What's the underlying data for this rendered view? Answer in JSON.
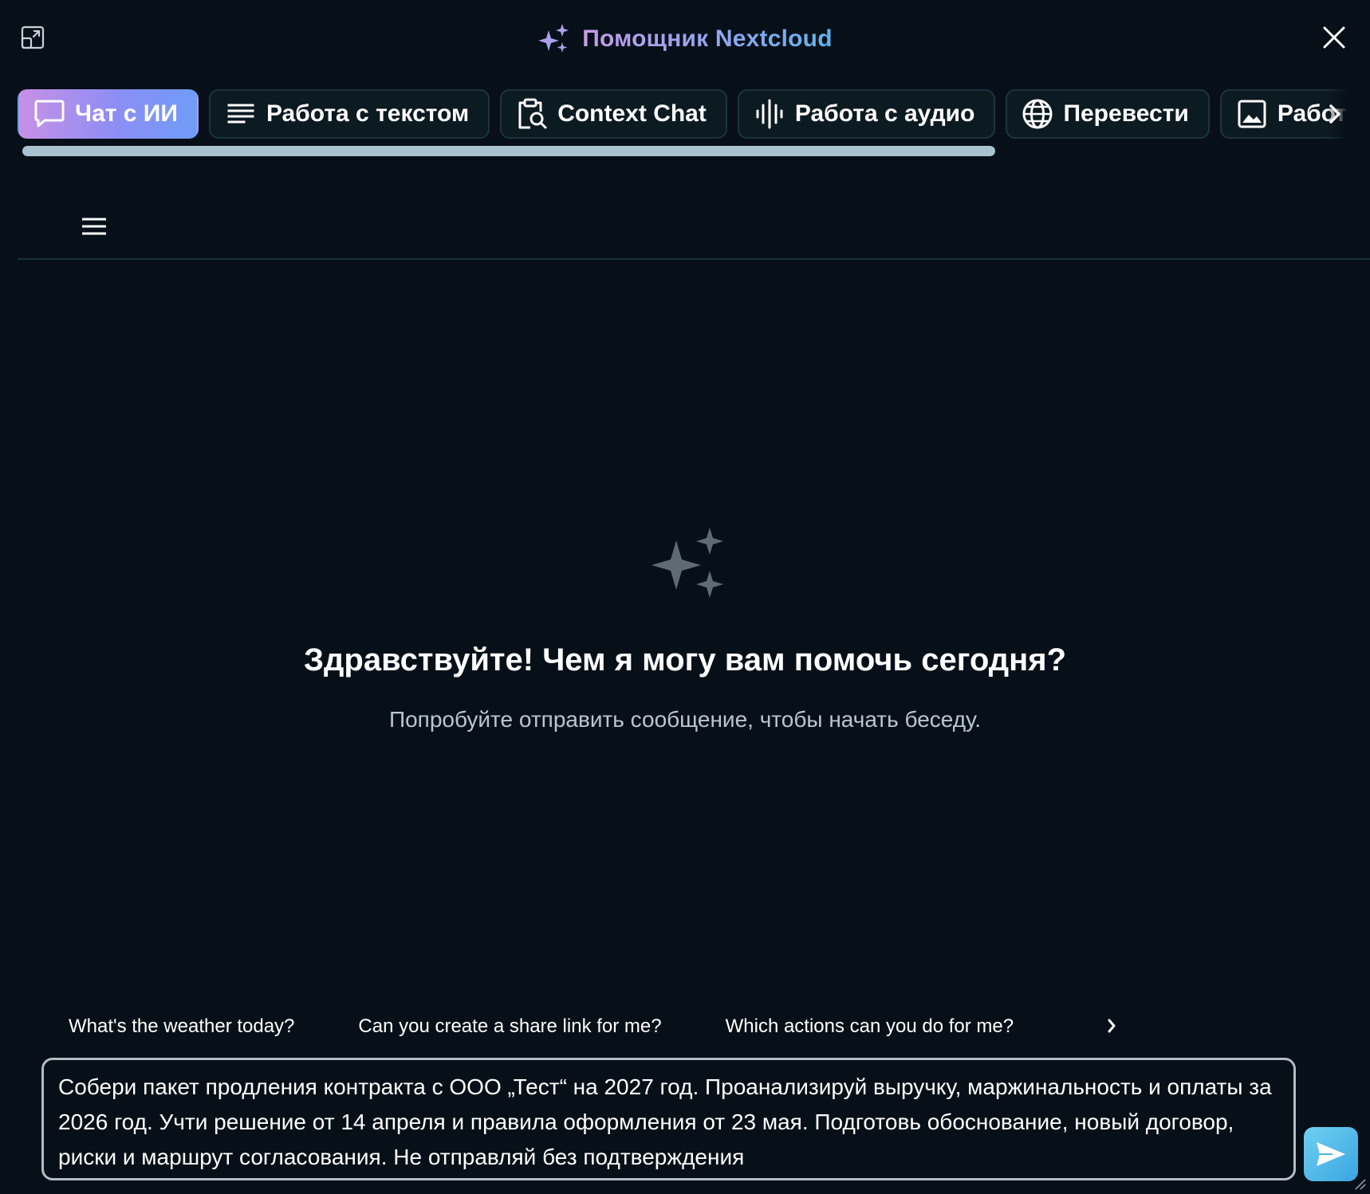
{
  "window": {
    "title": "Помощник Nextcloud"
  },
  "tabs": [
    {
      "label": "Чат с ИИ",
      "icon": "chat-bubble-icon",
      "active": true
    },
    {
      "label": "Работа с текстом",
      "icon": "text-lines-icon",
      "active": false
    },
    {
      "label": "Context Chat",
      "icon": "clipboard-search-icon",
      "active": false
    },
    {
      "label": "Работа с аудио",
      "icon": "waveform-icon",
      "active": false
    },
    {
      "label": "Перевести",
      "icon": "globe-icon",
      "active": false
    },
    {
      "label": "Работа с изображениями",
      "icon": "image-icon",
      "active": false
    }
  ],
  "empty_state": {
    "title": "Здравствуйте! Чем я могу вам помочь сегодня?",
    "subtitle": "Попробуйте отправить сообщение, чтобы начать беседу."
  },
  "suggestions": [
    "What's the weather today?",
    "Can you create a share link for me?",
    "Which actions can you do for me?"
  ],
  "input": {
    "value": "Собери пакет продления контракта с ООО „Тест“ на 2027 год. Проанализируй выручку, маржинальность и оплаты за 2026 год. Учти решение от 14 апреля и правила оформления от 23 мая. Подготовь обоснование, новый договор, риски и маршрут согласования. Не отправляй без подтверждения"
  },
  "colors": {
    "background": "#071018",
    "active_tab_gradient_start": "#c890e6",
    "active_tab_gradient_end": "#6f9cf6",
    "send_button": "#3aa5e2",
    "scrollbar": "#a9c2cf"
  }
}
